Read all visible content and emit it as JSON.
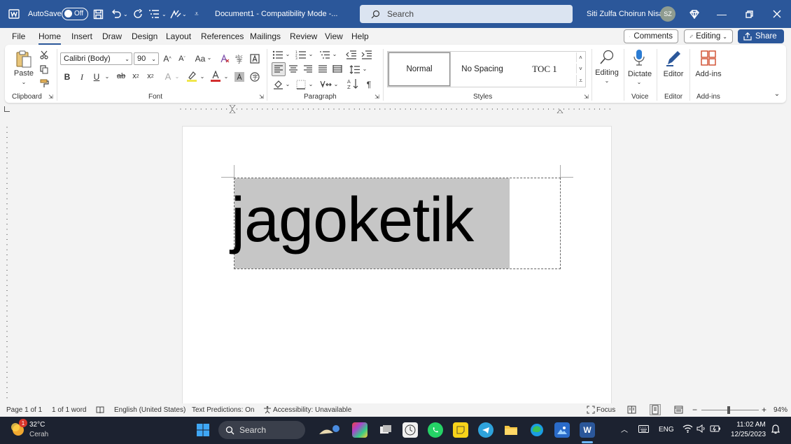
{
  "titlebar": {
    "autosave_label": "AutoSave",
    "autosave_state": "Off",
    "doc_title": "Document1  -  Compatibility Mode  -...",
    "search_placeholder": "Search",
    "user_name": "Siti Zulfa Choirun Nisa",
    "user_initials": "SZ"
  },
  "menu": {
    "tabs": [
      "File",
      "Home",
      "Insert",
      "Draw",
      "Design",
      "Layout",
      "References",
      "Mailings",
      "Review",
      "View",
      "Help"
    ],
    "active_tab": "Home",
    "comments_label": "Comments",
    "editing_label": "Editing",
    "share_label": "Share"
  },
  "ribbon": {
    "clipboard": {
      "paste_label": "Paste",
      "group_label": "Clipboard"
    },
    "font": {
      "font_name": "Calibri (Body)",
      "font_size": "90",
      "group_label": "Font",
      "case_label": "Aa"
    },
    "paragraph": {
      "group_label": "Paragraph"
    },
    "styles": {
      "items": [
        "Normal",
        "No Spacing",
        "TOC 1"
      ],
      "selected": "Normal",
      "group_label": "Styles"
    },
    "editing": {
      "label": "Editing"
    },
    "voice": {
      "dictate_label": "Dictate",
      "group_label": "Voice"
    },
    "editor": {
      "label": "Editor",
      "group_label": "Editor"
    },
    "addins": {
      "label": "Add-ins",
      "group_label": "Add-ins"
    }
  },
  "document": {
    "text": "jagoketik"
  },
  "statusbar": {
    "page": "Page 1 of 1",
    "words": "1 of 1 word",
    "language": "English (United States)",
    "predictions": "Text Predictions: On",
    "accessibility": "Accessibility: Unavailable",
    "focus": "Focus",
    "zoom": "94%"
  },
  "taskbar": {
    "temperature": "32°C",
    "weather": "Cerah",
    "weather_badge": "1",
    "search_label": "Search",
    "language": "ENG",
    "time": "11:02 AM",
    "date": "12/25/2023"
  },
  "colors": {
    "title_blue": "#2b579a",
    "selection_gray": "#c6c6c6",
    "taskbar_dark": "#1c2230"
  }
}
